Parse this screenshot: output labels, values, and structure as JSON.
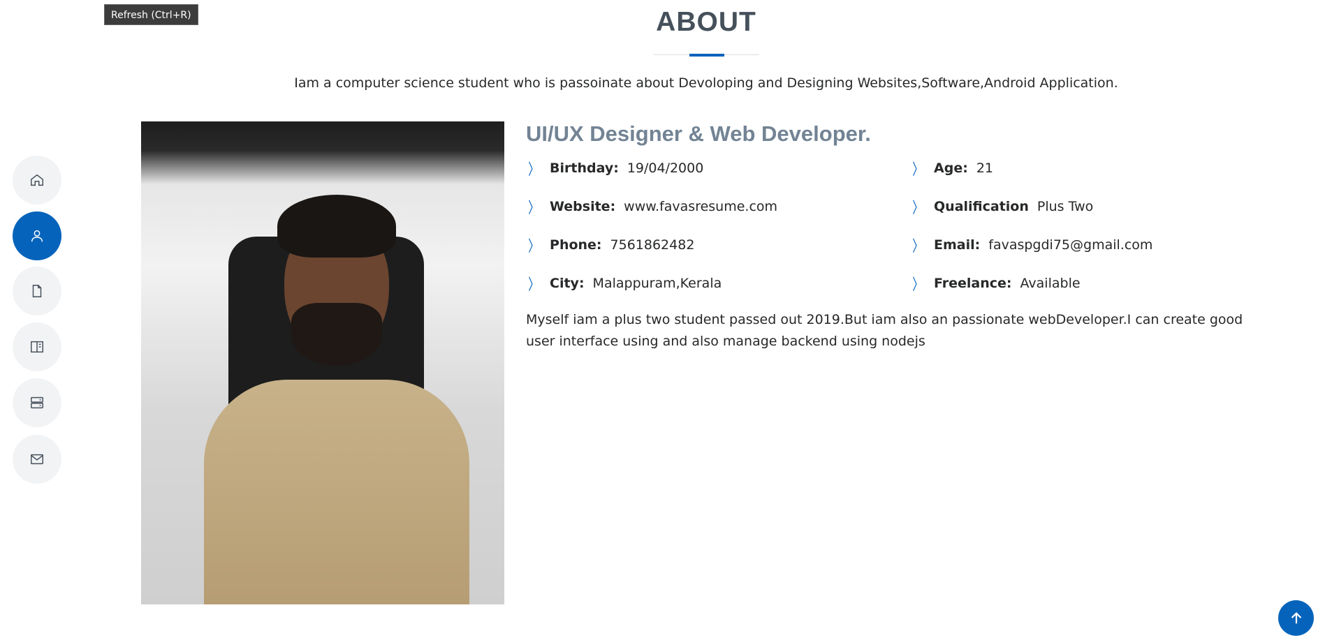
{
  "tooltip": "Refresh (Ctrl+R)",
  "section": {
    "title": "ABOUT",
    "intro": "Iam a computer science student who is passoinate about Devoloping and Designing Websites,Software,Android Application."
  },
  "about": {
    "heading": "UI/UX Designer & Web Developer.",
    "left": [
      {
        "label": "Birthday:",
        "value": "19/04/2000"
      },
      {
        "label": "Website:",
        "value": "www.favasresume.com"
      },
      {
        "label": "Phone:",
        "value": "7561862482"
      },
      {
        "label": "City:",
        "value": "Malappuram,Kerala"
      }
    ],
    "right": [
      {
        "label": "Age:",
        "value": "21"
      },
      {
        "label": "Qualification",
        "value": "Plus Two"
      },
      {
        "label": "Email:",
        "value": "favaspgdi75@gmail.com"
      },
      {
        "label": "Freelance:",
        "value": "Available"
      }
    ],
    "paragraph": "Myself iam a plus two student passed out 2019.But iam also an passionate webDeveloper.I can create good user interface using and also manage backend using nodejs"
  },
  "nav": [
    "home-icon",
    "person-icon",
    "file-icon",
    "book-icon",
    "server-icon",
    "envelope-icon"
  ],
  "colors": {
    "accent": "#0563bb",
    "heading": "#728394",
    "title": "#45505b"
  }
}
